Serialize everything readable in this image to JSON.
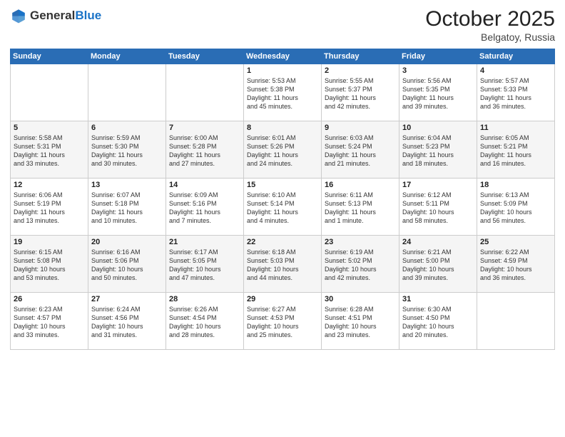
{
  "header": {
    "logo_general": "General",
    "logo_blue": "Blue",
    "month": "October 2025",
    "location": "Belgatoy, Russia"
  },
  "days_of_week": [
    "Sunday",
    "Monday",
    "Tuesday",
    "Wednesday",
    "Thursday",
    "Friday",
    "Saturday"
  ],
  "weeks": [
    [
      {
        "day": "",
        "info": ""
      },
      {
        "day": "",
        "info": ""
      },
      {
        "day": "",
        "info": ""
      },
      {
        "day": "1",
        "info": "Sunrise: 5:53 AM\nSunset: 5:38 PM\nDaylight: 11 hours\nand 45 minutes."
      },
      {
        "day": "2",
        "info": "Sunrise: 5:55 AM\nSunset: 5:37 PM\nDaylight: 11 hours\nand 42 minutes."
      },
      {
        "day": "3",
        "info": "Sunrise: 5:56 AM\nSunset: 5:35 PM\nDaylight: 11 hours\nand 39 minutes."
      },
      {
        "day": "4",
        "info": "Sunrise: 5:57 AM\nSunset: 5:33 PM\nDaylight: 11 hours\nand 36 minutes."
      }
    ],
    [
      {
        "day": "5",
        "info": "Sunrise: 5:58 AM\nSunset: 5:31 PM\nDaylight: 11 hours\nand 33 minutes."
      },
      {
        "day": "6",
        "info": "Sunrise: 5:59 AM\nSunset: 5:30 PM\nDaylight: 11 hours\nand 30 minutes."
      },
      {
        "day": "7",
        "info": "Sunrise: 6:00 AM\nSunset: 5:28 PM\nDaylight: 11 hours\nand 27 minutes."
      },
      {
        "day": "8",
        "info": "Sunrise: 6:01 AM\nSunset: 5:26 PM\nDaylight: 11 hours\nand 24 minutes."
      },
      {
        "day": "9",
        "info": "Sunrise: 6:03 AM\nSunset: 5:24 PM\nDaylight: 11 hours\nand 21 minutes."
      },
      {
        "day": "10",
        "info": "Sunrise: 6:04 AM\nSunset: 5:23 PM\nDaylight: 11 hours\nand 18 minutes."
      },
      {
        "day": "11",
        "info": "Sunrise: 6:05 AM\nSunset: 5:21 PM\nDaylight: 11 hours\nand 16 minutes."
      }
    ],
    [
      {
        "day": "12",
        "info": "Sunrise: 6:06 AM\nSunset: 5:19 PM\nDaylight: 11 hours\nand 13 minutes."
      },
      {
        "day": "13",
        "info": "Sunrise: 6:07 AM\nSunset: 5:18 PM\nDaylight: 11 hours\nand 10 minutes."
      },
      {
        "day": "14",
        "info": "Sunrise: 6:09 AM\nSunset: 5:16 PM\nDaylight: 11 hours\nand 7 minutes."
      },
      {
        "day": "15",
        "info": "Sunrise: 6:10 AM\nSunset: 5:14 PM\nDaylight: 11 hours\nand 4 minutes."
      },
      {
        "day": "16",
        "info": "Sunrise: 6:11 AM\nSunset: 5:13 PM\nDaylight: 11 hours\nand 1 minute."
      },
      {
        "day": "17",
        "info": "Sunrise: 6:12 AM\nSunset: 5:11 PM\nDaylight: 10 hours\nand 58 minutes."
      },
      {
        "day": "18",
        "info": "Sunrise: 6:13 AM\nSunset: 5:09 PM\nDaylight: 10 hours\nand 56 minutes."
      }
    ],
    [
      {
        "day": "19",
        "info": "Sunrise: 6:15 AM\nSunset: 5:08 PM\nDaylight: 10 hours\nand 53 minutes."
      },
      {
        "day": "20",
        "info": "Sunrise: 6:16 AM\nSunset: 5:06 PM\nDaylight: 10 hours\nand 50 minutes."
      },
      {
        "day": "21",
        "info": "Sunrise: 6:17 AM\nSunset: 5:05 PM\nDaylight: 10 hours\nand 47 minutes."
      },
      {
        "day": "22",
        "info": "Sunrise: 6:18 AM\nSunset: 5:03 PM\nDaylight: 10 hours\nand 44 minutes."
      },
      {
        "day": "23",
        "info": "Sunrise: 6:19 AM\nSunset: 5:02 PM\nDaylight: 10 hours\nand 42 minutes."
      },
      {
        "day": "24",
        "info": "Sunrise: 6:21 AM\nSunset: 5:00 PM\nDaylight: 10 hours\nand 39 minutes."
      },
      {
        "day": "25",
        "info": "Sunrise: 6:22 AM\nSunset: 4:59 PM\nDaylight: 10 hours\nand 36 minutes."
      }
    ],
    [
      {
        "day": "26",
        "info": "Sunrise: 6:23 AM\nSunset: 4:57 PM\nDaylight: 10 hours\nand 33 minutes."
      },
      {
        "day": "27",
        "info": "Sunrise: 6:24 AM\nSunset: 4:56 PM\nDaylight: 10 hours\nand 31 minutes."
      },
      {
        "day": "28",
        "info": "Sunrise: 6:26 AM\nSunset: 4:54 PM\nDaylight: 10 hours\nand 28 minutes."
      },
      {
        "day": "29",
        "info": "Sunrise: 6:27 AM\nSunset: 4:53 PM\nDaylight: 10 hours\nand 25 minutes."
      },
      {
        "day": "30",
        "info": "Sunrise: 6:28 AM\nSunset: 4:51 PM\nDaylight: 10 hours\nand 23 minutes."
      },
      {
        "day": "31",
        "info": "Sunrise: 6:30 AM\nSunset: 4:50 PM\nDaylight: 10 hours\nand 20 minutes."
      },
      {
        "day": "",
        "info": ""
      }
    ]
  ]
}
